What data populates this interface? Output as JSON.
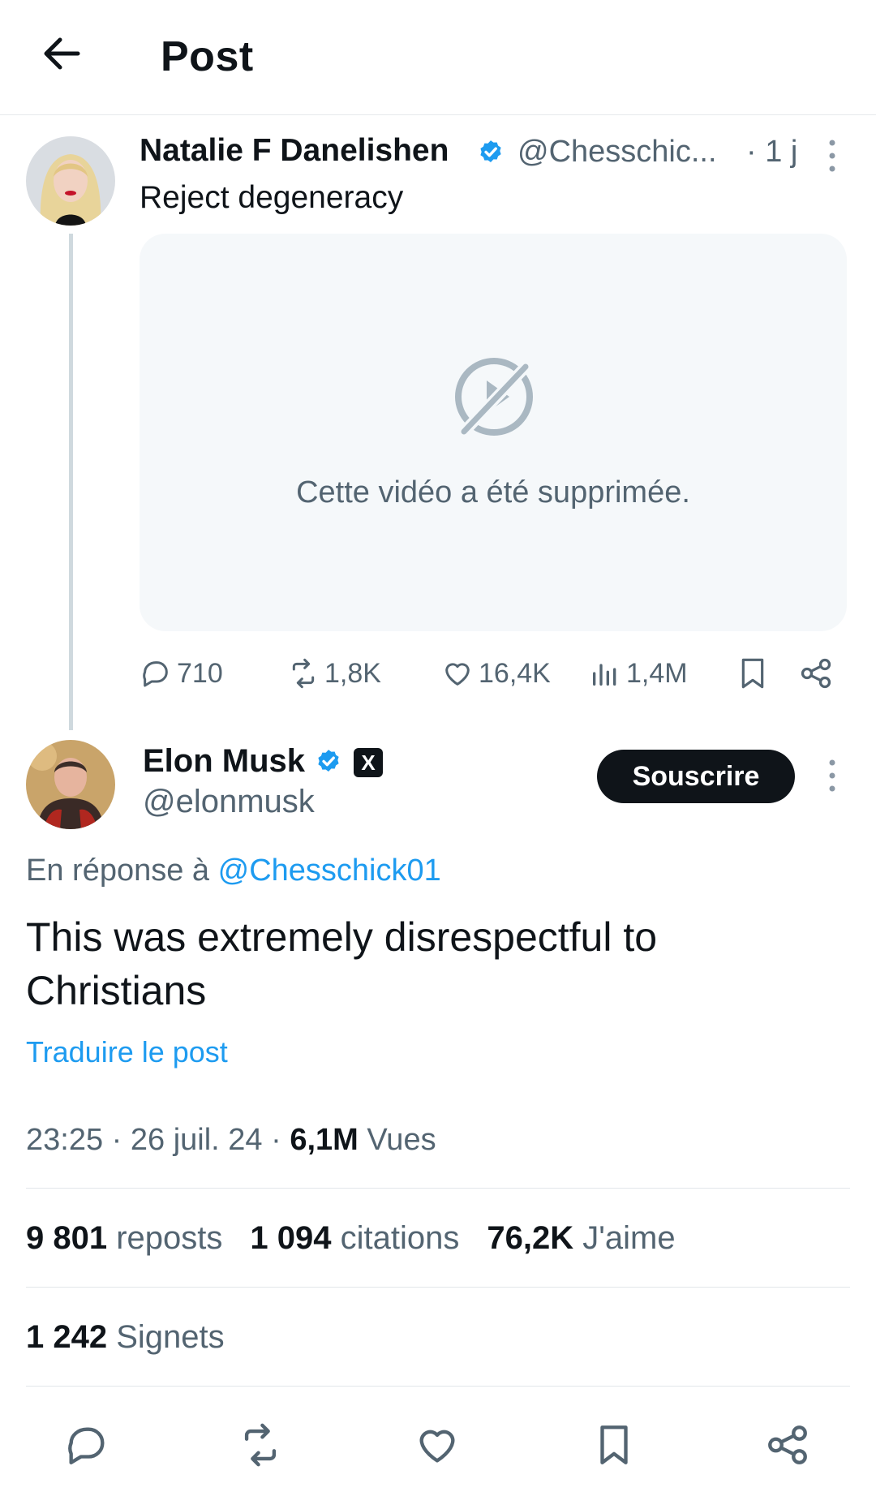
{
  "header": {
    "title": "Post"
  },
  "parent_post": {
    "author_name": "Natalie F Danelishen",
    "handle": "@Chesschic...",
    "time": "· 1 j",
    "text": "Reject degeneracy",
    "media_message": "Cette vidéo a été supprimée.",
    "actions": {
      "replies": "710",
      "reposts": "1,8K",
      "likes": "16,4K",
      "views": "1,4M"
    }
  },
  "main_post": {
    "author_name": "Elon Musk",
    "handle": "@elonmusk",
    "subscribe_label": "Souscrire",
    "x_badge": "X",
    "reply_prefix": "En réponse à",
    "reply_mention": "@Chesschick01",
    "text": "This was extremely disrespectful to Christians",
    "translate_label": "Traduire le post",
    "time": "23:25",
    "date": "26 juil. 24",
    "views_count": "6,1M",
    "views_label": "Vues",
    "sep": "·",
    "reposts_count": "9 801",
    "reposts_label": "reposts",
    "quotes_count": "1 094",
    "quotes_label": "citations",
    "likes_count": "76,2K",
    "likes_label": "J'aime",
    "bookmarks_count": "1 242",
    "bookmarks_label": "Signets"
  },
  "colors": {
    "accent": "#1d9bf0",
    "text": "#0f1419",
    "muted": "#536471",
    "media_bg": "#f5f8fa"
  }
}
